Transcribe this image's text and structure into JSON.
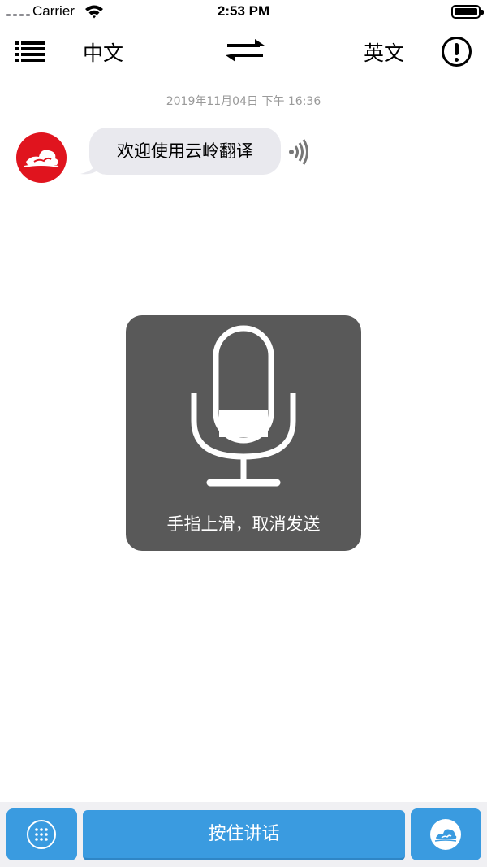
{
  "status_bar": {
    "carrier": "Carrier",
    "time": "2:53 PM",
    "icons": [
      "signal-dots-icon",
      "wifi-icon",
      "battery-icon"
    ]
  },
  "nav": {
    "source_language": "中文",
    "target_language": "英文",
    "icons": [
      "list-menu-icon",
      "swap-arrows-icon",
      "exclamation-circle-icon"
    ]
  },
  "chat": {
    "timestamp": "2019年11月04日 下午 16:36",
    "messages": [
      {
        "sender": "bot",
        "avatar_icon": "cloud-logo-icon",
        "text": "欢迎使用云岭翻译",
        "action_icon": "speaker-wave-icon"
      }
    ]
  },
  "recording": {
    "icon": "microphone-icon",
    "hint": "手指上滑，取消发送",
    "level": 0.25
  },
  "bottom_bar": {
    "talk_label": "按住讲话",
    "icons": [
      "keypad-grid-icon",
      "cloud-logo-icon"
    ]
  },
  "colors": {
    "accent": "#3a9be0",
    "logo_red": "#e0141e",
    "overlay": "#595959",
    "bubble": "#e9e9ee",
    "timestamp": "#9a9a9a"
  }
}
